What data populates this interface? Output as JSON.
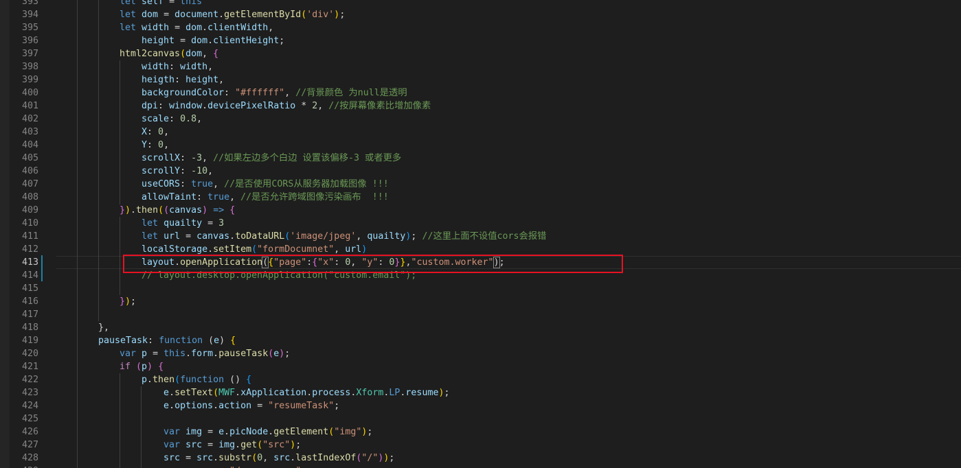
{
  "editor": {
    "current_line": 413,
    "highlight_color": "#e81123",
    "lines": [
      {
        "no": "393",
        "segs": [
          [
            "let",
            "kw"
          ],
          [
            " ",
            "p"
          ],
          [
            "self",
            "var"
          ],
          [
            " = ",
            "p"
          ],
          [
            "this",
            "kw"
          ]
        ]
      },
      {
        "no": "394",
        "segs": [
          [
            "let",
            "kw"
          ],
          [
            " ",
            "p"
          ],
          [
            "dom",
            "var"
          ],
          [
            " = ",
            "p"
          ],
          [
            "document",
            "var"
          ],
          [
            ".",
            "p"
          ],
          [
            "getElementById",
            "fn"
          ],
          [
            "(",
            "b1"
          ],
          [
            "'div'",
            "str"
          ],
          [
            ")",
            "b1"
          ],
          [
            ";",
            "p"
          ]
        ]
      },
      {
        "no": "395",
        "segs": [
          [
            "let",
            "kw"
          ],
          [
            " ",
            "p"
          ],
          [
            "width",
            "var"
          ],
          [
            " = ",
            "p"
          ],
          [
            "dom",
            "var"
          ],
          [
            ".",
            "p"
          ],
          [
            "clientWidth",
            "var"
          ],
          [
            ",",
            "p"
          ]
        ]
      },
      {
        "no": "396",
        "segs": [
          [
            "    height",
            "var"
          ],
          [
            " = ",
            "p"
          ],
          [
            "dom",
            "var"
          ],
          [
            ".",
            "p"
          ],
          [
            "clientHeight",
            "var"
          ],
          [
            ";",
            "p"
          ]
        ]
      },
      {
        "no": "397",
        "segs": [
          [
            "html2canvas",
            "fn"
          ],
          [
            "(",
            "b1"
          ],
          [
            "dom",
            "var"
          ],
          [
            ", ",
            "p"
          ],
          [
            "{",
            "b2"
          ]
        ]
      },
      {
        "no": "398",
        "segs": [
          [
            "    width",
            "var"
          ],
          [
            ": ",
            "p"
          ],
          [
            "width",
            "var"
          ],
          [
            ",",
            "p"
          ]
        ]
      },
      {
        "no": "399",
        "segs": [
          [
            "    heigth",
            "var"
          ],
          [
            ": ",
            "p"
          ],
          [
            "height",
            "var"
          ],
          [
            ",",
            "p"
          ]
        ]
      },
      {
        "no": "400",
        "segs": [
          [
            "    backgroundColor",
            "var"
          ],
          [
            ": ",
            "p"
          ],
          [
            "\"#ffffff\"",
            "str"
          ],
          [
            ", ",
            "p"
          ],
          [
            "//背景颜色 为null是透明",
            "cm"
          ]
        ]
      },
      {
        "no": "401",
        "segs": [
          [
            "    dpi",
            "var"
          ],
          [
            ": ",
            "p"
          ],
          [
            "window",
            "var"
          ],
          [
            ".",
            "p"
          ],
          [
            "devicePixelRatio",
            "var"
          ],
          [
            " * ",
            "p"
          ],
          [
            "2",
            "num"
          ],
          [
            ", ",
            "p"
          ],
          [
            "//按屏幕像素比增加像素",
            "cm"
          ]
        ]
      },
      {
        "no": "402",
        "segs": [
          [
            "    scale",
            "var"
          ],
          [
            ": ",
            "p"
          ],
          [
            "0.8",
            "num"
          ],
          [
            ",",
            "p"
          ]
        ]
      },
      {
        "no": "403",
        "segs": [
          [
            "    X",
            "var"
          ],
          [
            ": ",
            "p"
          ],
          [
            "0",
            "num"
          ],
          [
            ",",
            "p"
          ]
        ]
      },
      {
        "no": "404",
        "segs": [
          [
            "    Y",
            "var"
          ],
          [
            ": ",
            "p"
          ],
          [
            "0",
            "num"
          ],
          [
            ",",
            "p"
          ]
        ]
      },
      {
        "no": "405",
        "segs": [
          [
            "    scrollX",
            "var"
          ],
          [
            ": ",
            "p"
          ],
          [
            "-3",
            "num"
          ],
          [
            ", ",
            "p"
          ],
          [
            "//如果左边多个白边 设置该偏移-3 或者更多",
            "cm"
          ]
        ]
      },
      {
        "no": "406",
        "segs": [
          [
            "    scrollY",
            "var"
          ],
          [
            ": ",
            "p"
          ],
          [
            "-10",
            "num"
          ],
          [
            ",",
            "p"
          ]
        ]
      },
      {
        "no": "407",
        "segs": [
          [
            "    useCORS",
            "var"
          ],
          [
            ": ",
            "p"
          ],
          [
            "true",
            "kw"
          ],
          [
            ", ",
            "p"
          ],
          [
            "//是否使用CORS从服务器加载图像 !!!",
            "cm"
          ]
        ]
      },
      {
        "no": "408",
        "segs": [
          [
            "    allowTaint",
            "var"
          ],
          [
            ": ",
            "p"
          ],
          [
            "true",
            "kw"
          ],
          [
            ", ",
            "p"
          ],
          [
            "//是否允许跨域图像污染画布  !!!",
            "cm"
          ]
        ]
      },
      {
        "no": "409",
        "segs": [
          [
            "}",
            "b2"
          ],
          [
            ")",
            "b1"
          ],
          [
            ".",
            "p"
          ],
          [
            "then",
            "fn"
          ],
          [
            "(",
            "b1"
          ],
          [
            "(",
            "b2"
          ],
          [
            "canvas",
            "var"
          ],
          [
            ")",
            "b2"
          ],
          [
            " ",
            "p"
          ],
          [
            "=>",
            "kw"
          ],
          [
            " ",
            "p"
          ],
          [
            "{",
            "b2"
          ]
        ]
      },
      {
        "no": "410",
        "segs": [
          [
            "    let",
            "kw"
          ],
          [
            " ",
            "p"
          ],
          [
            "quailty",
            "var"
          ],
          [
            " = ",
            "p"
          ],
          [
            "3",
            "num"
          ]
        ]
      },
      {
        "no": "411",
        "segs": [
          [
            "    let",
            "kw"
          ],
          [
            " ",
            "p"
          ],
          [
            "url",
            "var"
          ],
          [
            " = ",
            "p"
          ],
          [
            "canvas",
            "var"
          ],
          [
            ".",
            "p"
          ],
          [
            "toDataURL",
            "fn"
          ],
          [
            "(",
            "b3"
          ],
          [
            "'image/jpeg'",
            "str"
          ],
          [
            ", ",
            "p"
          ],
          [
            "quailty",
            "var"
          ],
          [
            ")",
            "b3"
          ],
          [
            "; ",
            "p"
          ],
          [
            "//这里上面不设值cors会报错",
            "cm"
          ]
        ]
      },
      {
        "no": "412",
        "segs": [
          [
            "    localStorage",
            "var"
          ],
          [
            ".",
            "p"
          ],
          [
            "setItem",
            "fn"
          ],
          [
            "(",
            "b3"
          ],
          [
            "\"formDocumnet\"",
            "str"
          ],
          [
            ", ",
            "p"
          ],
          [
            "url",
            "var"
          ],
          [
            ")",
            "b3"
          ]
        ]
      },
      {
        "no": "413",
        "segs": [
          [
            "    layout",
            "var"
          ],
          [
            ".",
            "p"
          ],
          [
            "openApplication",
            "fn"
          ],
          [
            "(",
            "bm"
          ],
          [
            "{",
            "b1"
          ],
          [
            "\"page\"",
            "str"
          ],
          [
            ":",
            "p"
          ],
          [
            "{",
            "b2"
          ],
          [
            "\"x\"",
            "str"
          ],
          [
            ": ",
            "p"
          ],
          [
            "0",
            "num"
          ],
          [
            ", ",
            "p"
          ],
          [
            "\"y\"",
            "str"
          ],
          [
            ": ",
            "p"
          ],
          [
            "0",
            "num"
          ],
          [
            "}",
            "b2"
          ],
          [
            "}",
            "b1"
          ],
          [
            ",",
            "p"
          ],
          [
            "\"custom.worker\"",
            "str"
          ],
          [
            ")",
            "bm"
          ],
          [
            ";",
            "p"
          ]
        ]
      },
      {
        "no": "414",
        "segs": [
          [
            "    // layout.desktop.openApplication(\"custom.email\");",
            "cm"
          ]
        ]
      },
      {
        "no": "415",
        "segs": []
      },
      {
        "no": "416",
        "segs": [
          [
            "}",
            "b2"
          ],
          [
            ")",
            "b1"
          ],
          [
            ";",
            "p"
          ]
        ]
      },
      {
        "no": "417",
        "segs": []
      },
      {
        "no": "418",
        "segs": [
          [
            "},",
            "p"
          ]
        ]
      },
      {
        "no": "419",
        "segs": [
          [
            "pauseTask",
            "var"
          ],
          [
            ": ",
            "p"
          ],
          [
            "function",
            "kw"
          ],
          [
            " (",
            "p"
          ],
          [
            "e",
            "var"
          ],
          [
            ") ",
            "p"
          ],
          [
            "{",
            "b1"
          ]
        ]
      },
      {
        "no": "420",
        "segs": [
          [
            "var",
            "kw"
          ],
          [
            " ",
            "p"
          ],
          [
            "p",
            "var"
          ],
          [
            " = ",
            "p"
          ],
          [
            "this",
            "kw"
          ],
          [
            ".",
            "p"
          ],
          [
            "form",
            "var"
          ],
          [
            ".",
            "p"
          ],
          [
            "pauseTask",
            "fn"
          ],
          [
            "(",
            "b2"
          ],
          [
            "e",
            "var"
          ],
          [
            ")",
            "b2"
          ],
          [
            ";",
            "p"
          ]
        ]
      },
      {
        "no": "421",
        "segs": [
          [
            "if",
            "ctl"
          ],
          [
            " ",
            "p"
          ],
          [
            "(",
            "b2"
          ],
          [
            "p",
            "var"
          ],
          [
            ")",
            "b2"
          ],
          [
            " ",
            "p"
          ],
          [
            "{",
            "b2"
          ]
        ]
      },
      {
        "no": "422",
        "segs": [
          [
            "    p",
            "var"
          ],
          [
            ".",
            "p"
          ],
          [
            "then",
            "fn"
          ],
          [
            "(",
            "b3"
          ],
          [
            "function",
            "kw"
          ],
          [
            " () ",
            "p"
          ],
          [
            "{",
            "b3"
          ]
        ]
      },
      {
        "no": "423",
        "segs": [
          [
            "        e",
            "var"
          ],
          [
            ".",
            "p"
          ],
          [
            "setText",
            "fn"
          ],
          [
            "(",
            "b1"
          ],
          [
            "MWF",
            "cls"
          ],
          [
            ".",
            "p"
          ],
          [
            "xApplication",
            "var"
          ],
          [
            ".",
            "p"
          ],
          [
            "process",
            "var"
          ],
          [
            ".",
            "p"
          ],
          [
            "Xform",
            "cls"
          ],
          [
            ".",
            "p"
          ],
          [
            "LP",
            "kw"
          ],
          [
            ".",
            "p"
          ],
          [
            "resume",
            "var"
          ],
          [
            ")",
            "b1"
          ],
          [
            ";",
            "p"
          ]
        ]
      },
      {
        "no": "424",
        "segs": [
          [
            "        e",
            "var"
          ],
          [
            ".",
            "p"
          ],
          [
            "options",
            "var"
          ],
          [
            ".",
            "p"
          ],
          [
            "action",
            "var"
          ],
          [
            " = ",
            "p"
          ],
          [
            "\"resumeTask\"",
            "str"
          ],
          [
            ";",
            "p"
          ]
        ]
      },
      {
        "no": "425",
        "segs": []
      },
      {
        "no": "426",
        "segs": [
          [
            "        var",
            "kw"
          ],
          [
            " ",
            "p"
          ],
          [
            "img",
            "var"
          ],
          [
            " = ",
            "p"
          ],
          [
            "e",
            "var"
          ],
          [
            ".",
            "p"
          ],
          [
            "picNode",
            "var"
          ],
          [
            ".",
            "p"
          ],
          [
            "getElement",
            "fn"
          ],
          [
            "(",
            "b1"
          ],
          [
            "\"img\"",
            "str"
          ],
          [
            ")",
            "b1"
          ],
          [
            ";",
            "p"
          ]
        ]
      },
      {
        "no": "427",
        "segs": [
          [
            "        var",
            "kw"
          ],
          [
            " ",
            "p"
          ],
          [
            "src",
            "var"
          ],
          [
            " = ",
            "p"
          ],
          [
            "img",
            "var"
          ],
          [
            ".",
            "p"
          ],
          [
            "get",
            "fn"
          ],
          [
            "(",
            "b1"
          ],
          [
            "\"src\"",
            "str"
          ],
          [
            ")",
            "b1"
          ],
          [
            ";",
            "p"
          ]
        ]
      },
      {
        "no": "428",
        "segs": [
          [
            "        src",
            "var"
          ],
          [
            " = ",
            "p"
          ],
          [
            "src",
            "var"
          ],
          [
            ".",
            "p"
          ],
          [
            "substr",
            "fn"
          ],
          [
            "(",
            "b1"
          ],
          [
            "0",
            "num"
          ],
          [
            ", ",
            "p"
          ],
          [
            "src",
            "var"
          ],
          [
            ".",
            "p"
          ],
          [
            "lastIndexOf",
            "fn"
          ],
          [
            "(",
            "b2"
          ],
          [
            "\"/\"",
            "str"
          ],
          [
            ")",
            "b2"
          ],
          [
            ")",
            "b1"
          ],
          [
            ";",
            "p"
          ]
        ]
      },
      {
        "no": "429",
        "segs": [
          [
            "        src",
            "var"
          ],
          [
            " = ",
            "p"
          ],
          [
            "src",
            "var"
          ],
          [
            " + ",
            "p"
          ],
          [
            "\"/resume.png\"",
            "str"
          ],
          [
            ";",
            "p"
          ]
        ]
      }
    ]
  }
}
